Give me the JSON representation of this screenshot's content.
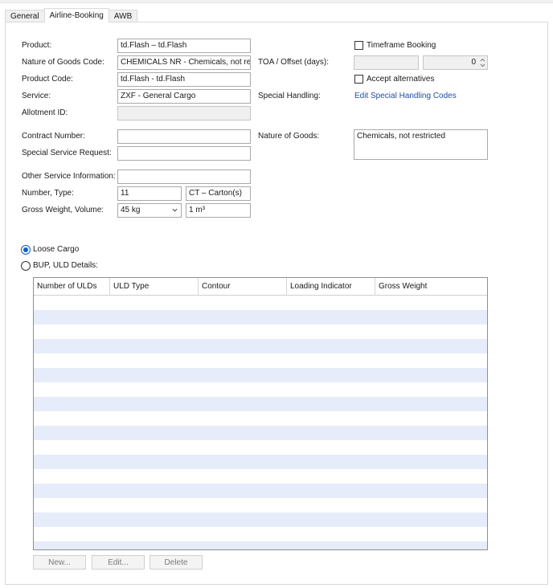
{
  "tabs": [
    {
      "label": "General"
    },
    {
      "label": "Airline-Booking"
    },
    {
      "label": "AWB"
    }
  ],
  "form": {
    "product": {
      "label": "Product:",
      "value": "td.Flash – td.Flash"
    },
    "nature_code": {
      "label": "Nature of Goods Code:",
      "value": "CHEMICALS NR - Chemicals, not restr"
    },
    "product_code": {
      "label": "Product Code:",
      "value": "td.Flash - td.Flash"
    },
    "service": {
      "label": "Service:",
      "value": "ZXF - General Cargo"
    },
    "allotment_id": {
      "label": "Allotment ID:",
      "value": ""
    },
    "contract_number": {
      "label": "Contract Number:",
      "value": ""
    },
    "special_service_request": {
      "label": "Special Service Request:",
      "value": ""
    },
    "other_service_information": {
      "label": "Other Service Information:",
      "value": ""
    },
    "number_type": {
      "label": "Number, Type:",
      "number": "11",
      "type": "CT – Carton(s)"
    },
    "gross_weight_volume": {
      "label": "Gross Weight, Volume:",
      "weight": "45 kg",
      "volume": "1 m³"
    }
  },
  "right": {
    "timeframe_booking": {
      "label": "Timeframe Booking",
      "checked": false
    },
    "toa_offset": {
      "label": "TOA / Offset (days):",
      "value": "",
      "offset": "0"
    },
    "accept_alternatives": {
      "label": "Accept alternatives",
      "checked": false
    },
    "special_handling": {
      "label": "Special Handling:",
      "link": "Edit Special Handling Codes"
    },
    "nature_of_goods": {
      "label": "Nature of Goods:",
      "value": "Chemicals, not restricted"
    }
  },
  "cargo_mode": {
    "loose": {
      "label": "Loose Cargo",
      "selected": true
    },
    "bup": {
      "label": "BUP, ULD Details:",
      "selected": false
    }
  },
  "uld_table": {
    "columns": [
      "Number of ULDs",
      "ULD Type",
      "Contour",
      "Loading Indicator",
      "Gross Weight"
    ],
    "rows": []
  },
  "buttons": {
    "new": "New...",
    "edit": "Edit...",
    "delete": "Delete"
  },
  "colors": {
    "accent": "#0b5cd6",
    "link": "#1f4fa8",
    "row_stripe": "#e6ecfa"
  }
}
